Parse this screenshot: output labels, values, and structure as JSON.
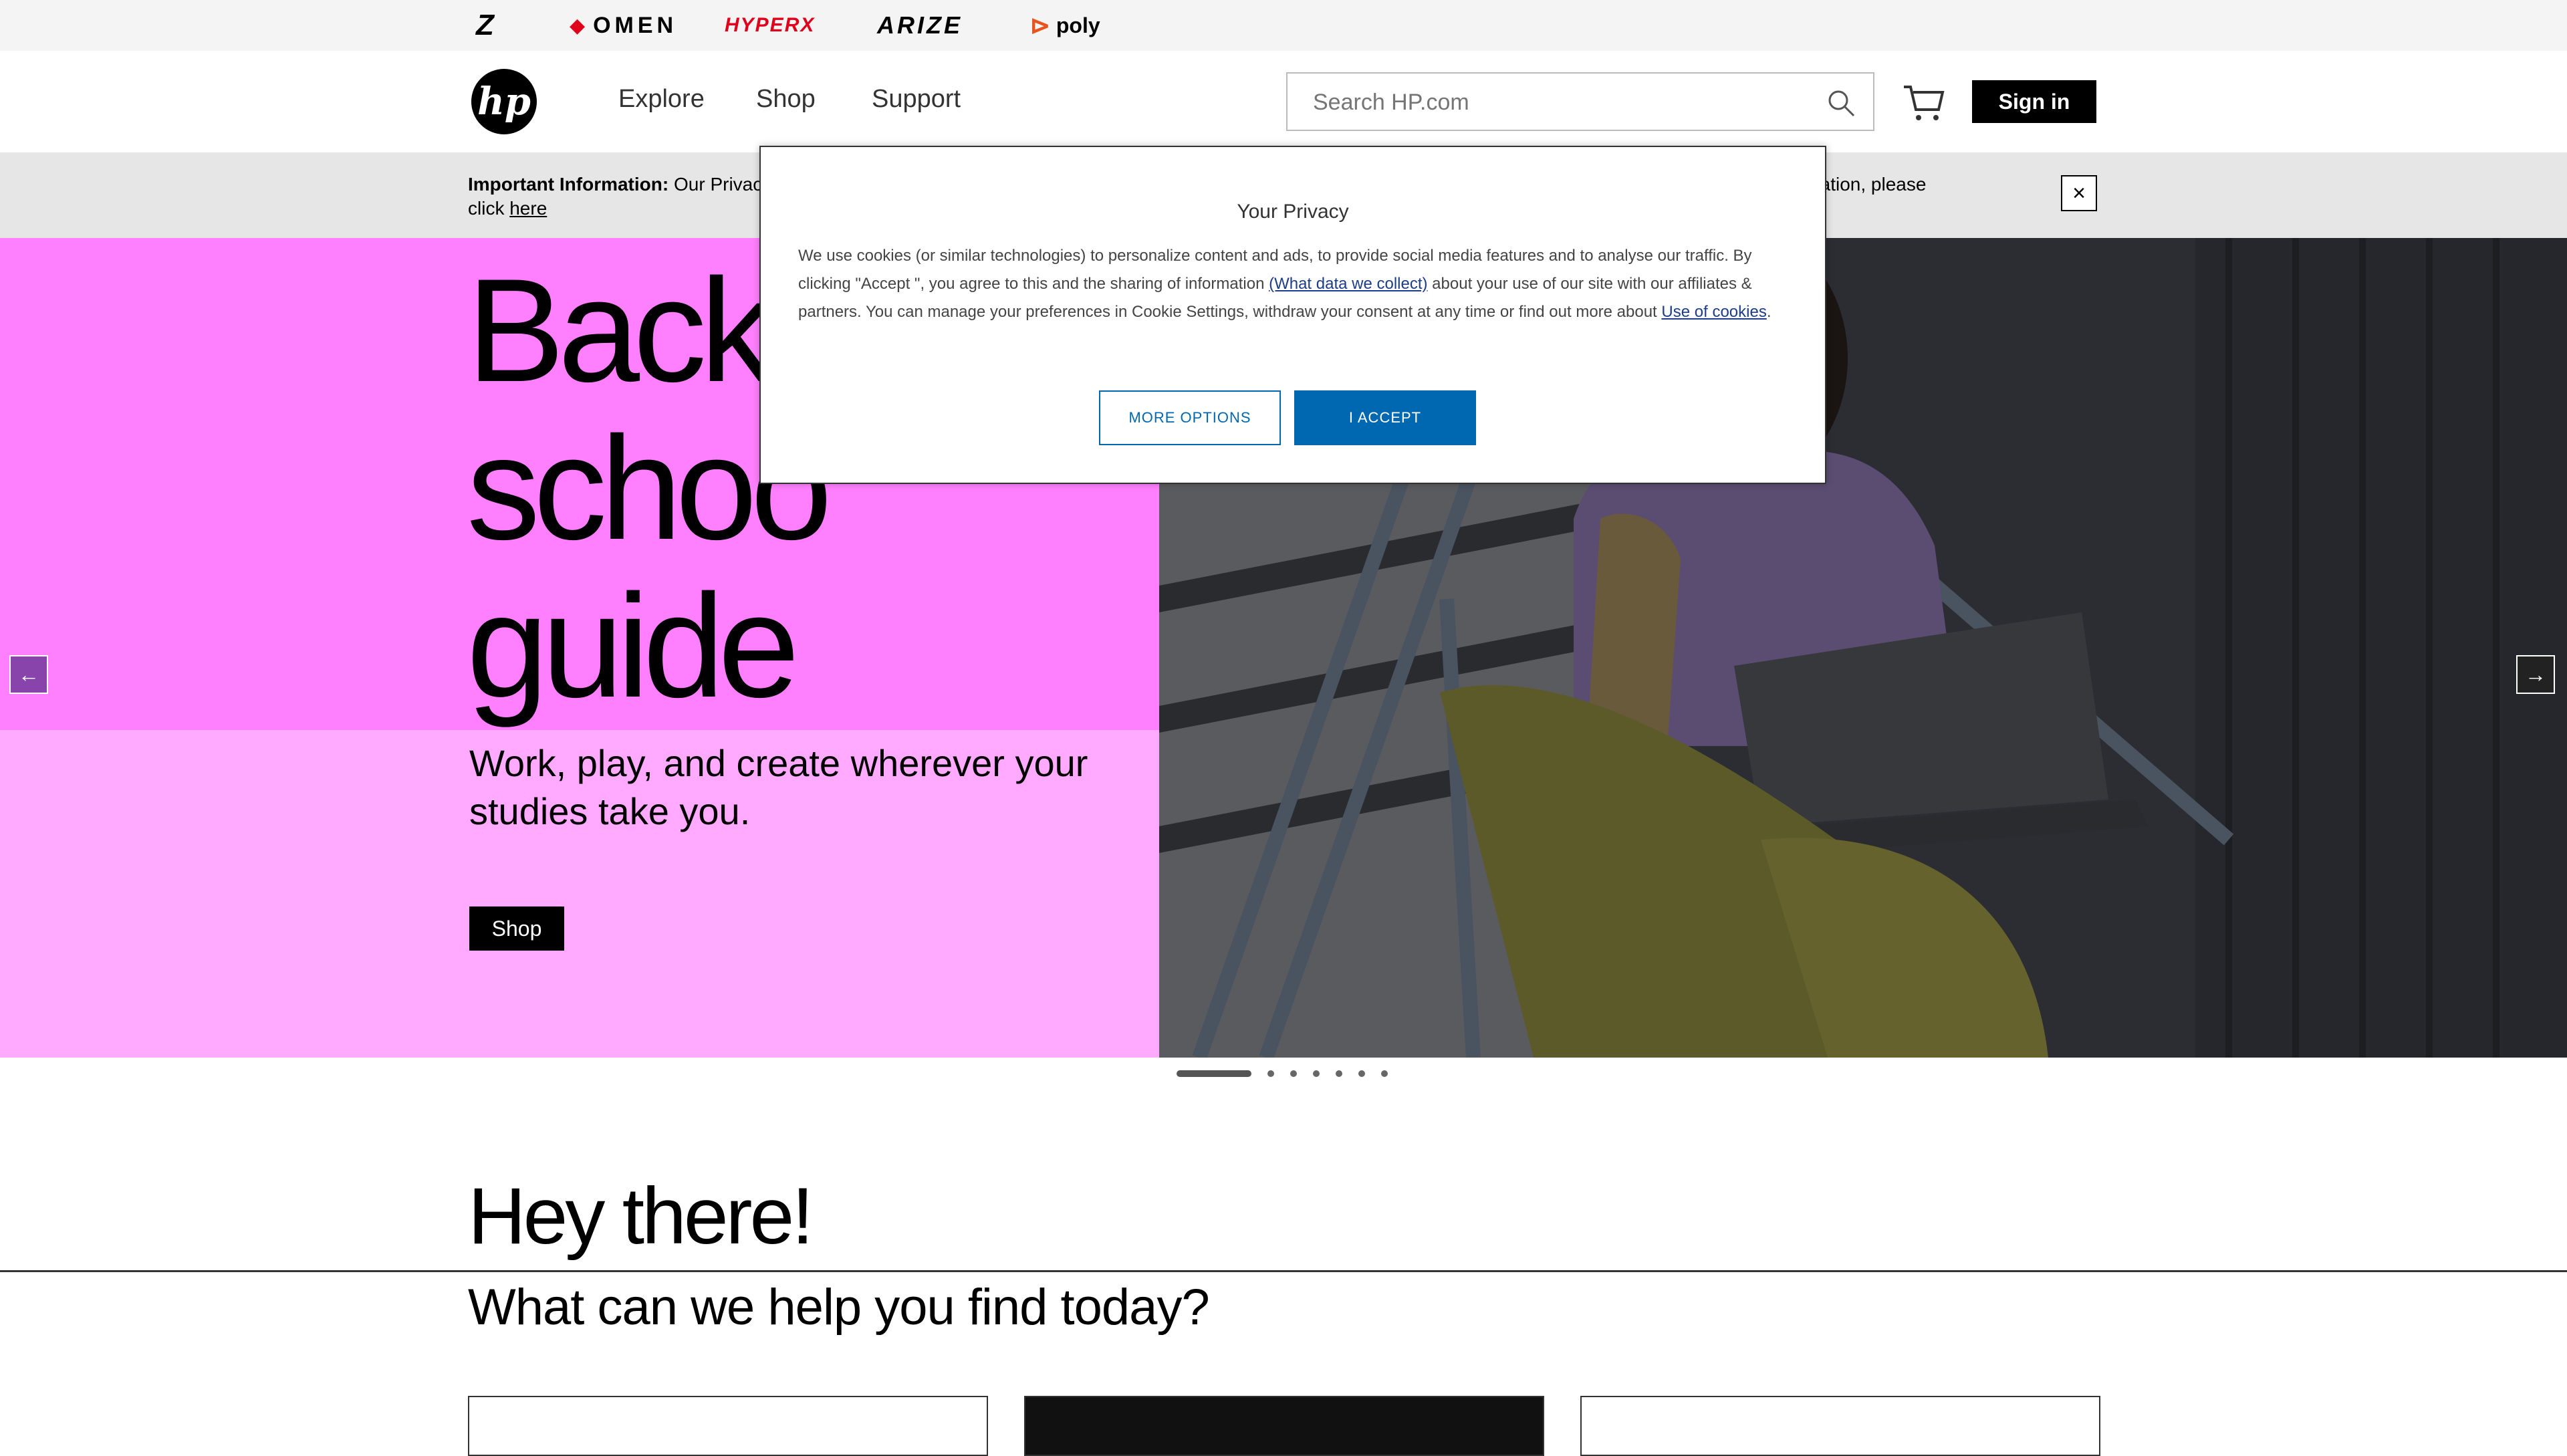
{
  "brands": [
    "Z",
    "OMEN",
    "HYPERX",
    "ARIZE",
    "poly"
  ],
  "header": {
    "logo": "hp",
    "nav": [
      "Explore",
      "Shop",
      "Support"
    ],
    "search_placeholder": "Search HP.com",
    "signin_label": "Sign in"
  },
  "notice": {
    "bold": "Important Information:",
    "text_start": "Our Privac",
    "text_end": "rmation, please",
    "click": "click",
    "link": "here",
    "close": "×"
  },
  "hero": {
    "headline_lines": [
      "Back",
      "schoo",
      "guide"
    ],
    "subtitle": "Work, play, and create wherever your studies take you.",
    "cta": "Shop",
    "prev": "←",
    "next": "→",
    "active_slide": 1,
    "slide_count": 7
  },
  "section": {
    "greeting": "Hey there!",
    "question": "What can we help you find today?"
  },
  "cookie": {
    "title": "Your Privacy",
    "text_a": "We use cookies (or similar technologies) to personalize content and ads, to provide social media features and to analyse our traffic. By clicking \"Accept \", you agree to this and the sharing of information ",
    "link_collect": "(What data we collect)",
    "text_b": " about your use of our site with our affiliates & partners. You can manage your preferences in Cookie Settings, withdraw your consent at any time or find out more about ",
    "link_cookies": "Use of cookies",
    "text_c": ".",
    "more_options": "MORE OPTIONS",
    "accept": "I ACCEPT"
  },
  "colors": {
    "hero_pink": "#ff80ff",
    "hero_pink_light": "#ffaaff",
    "accent_blue": "#0067b1"
  }
}
